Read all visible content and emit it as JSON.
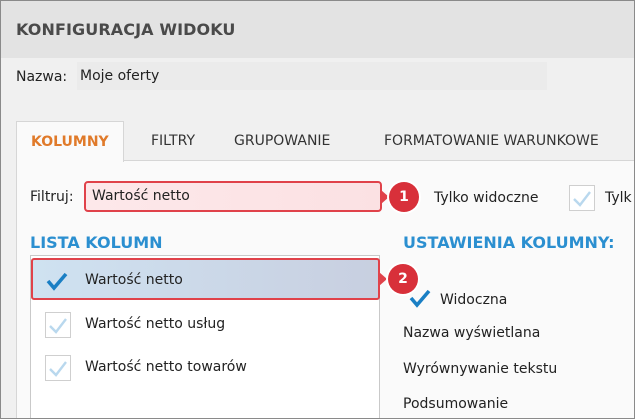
{
  "dialog": {
    "title": "KONFIGURACJA WIDOKU"
  },
  "name_field": {
    "label": "Nazwa:",
    "value": "Moje oferty"
  },
  "tabs": [
    {
      "label": "KOLUMNY",
      "active": true
    },
    {
      "label": "FILTRY",
      "active": false
    },
    {
      "label": "GRUPOWANIE",
      "active": false
    },
    {
      "label": "FORMATOWANIE WARUNKOWE",
      "active": false
    }
  ],
  "filter": {
    "label": "Filtruj:",
    "value": "Wartość netto",
    "only_visible_label": "Tylko widoczne",
    "second_label_partial": "Tylk"
  },
  "callouts": [
    "1",
    "2"
  ],
  "column_list": {
    "title": "LISTA KOLUMN",
    "items": [
      {
        "label": "Wartość netto",
        "checked": true,
        "selected": true
      },
      {
        "label": "Wartość netto usług",
        "checked": false,
        "selected": false
      },
      {
        "label": "Wartość netto towarów",
        "checked": false,
        "selected": false
      }
    ]
  },
  "column_settings": {
    "title": "USTAWIENIA KOLUMNY:",
    "visible_label": "Widoczna",
    "visible_checked": true,
    "fields": [
      "Nazwa wyświetlana",
      "Wyrównywanie tekstu",
      "Podsumowanie"
    ]
  },
  "colors": {
    "accent_orange": "#e07a2a",
    "accent_blue": "#2b8fd0",
    "highlight_red": "#d8303a",
    "check_blue": "#1a7fc4"
  }
}
